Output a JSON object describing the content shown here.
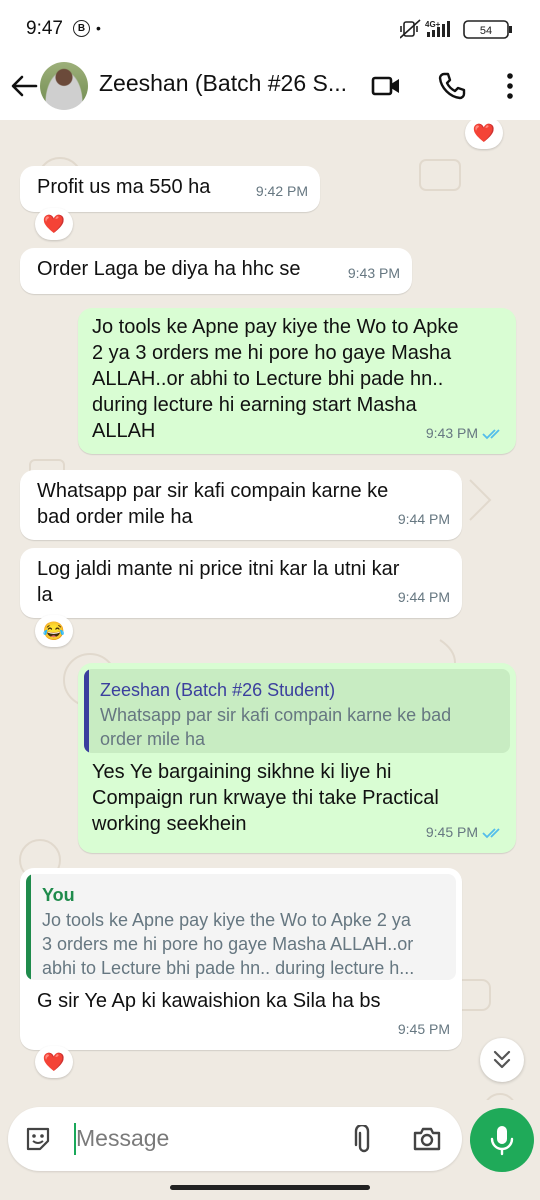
{
  "status_bar": {
    "time": "9:47",
    "badge": "B",
    "dot": "•",
    "network": "4G+",
    "battery": "54"
  },
  "header": {
    "title": "Zeeshan (Batch #26 S...",
    "icons": [
      "back-arrow-icon",
      "video-call-icon",
      "voice-call-icon",
      "more-options-icon"
    ]
  },
  "messages": [
    {
      "dir": "in",
      "text": "Profit us ma 550 ha",
      "time": "9:42 PM",
      "reaction": "❤️"
    },
    {
      "dir": "in",
      "text": "Order Laga be diya ha hhc se",
      "time": "9:43 PM"
    },
    {
      "dir": "out",
      "text": "Jo tools ke Apne pay kiye the Wo to Apke\n2 ya 3 orders me hi pore ho gaye Masha\nALLAH..or abhi to Lecture bhi pade hn..\nduring lecture hi earning start Masha\nALLAH",
      "time": "9:43 PM",
      "read": true
    },
    {
      "dir": "in",
      "text": "Whatsapp par sir kafi compain karne ke\nbad order mile ha",
      "time": "9:44 PM"
    },
    {
      "dir": "in",
      "text": "Log jaldi mante ni price itni kar la utni kar\nla",
      "time": "9:44 PM",
      "reaction": "😂"
    },
    {
      "dir": "out",
      "quote": {
        "name": "Zeeshan (Batch #26 Student)",
        "text": "Whatsapp par sir kafi compain karne ke bad\norder mile ha"
      },
      "text": "Yes Ye bargaining sikhne ki liye hi\nCompaign run krwaye thi take Practical\nworking seekhein",
      "time": "9:45 PM",
      "read": true
    },
    {
      "dir": "in",
      "quote": {
        "name": "You",
        "text": "Jo tools ke Apne pay kiye the Wo to Apke 2 ya\n3 orders me hi pore ho gaye Masha ALLAH..or\nabhi to Lecture bhi pade hn.. during lecture h..."
      },
      "text": "G sir Ye Ap ki kawaishion ka Sila ha bs",
      "time": "9:45 PM",
      "reaction": "❤️"
    }
  ],
  "top_reaction": "❤️",
  "input": {
    "placeholder": "Message"
  },
  "colors": {
    "accent": "#1faa59",
    "incoming": "#ffffff",
    "outgoing": "#d9fdd3",
    "wallpaper": "#efeae2",
    "tick_blue": "#53bdeb",
    "quote_green": "#1f8b4c",
    "quote_indigo": "#3b3f9e"
  }
}
